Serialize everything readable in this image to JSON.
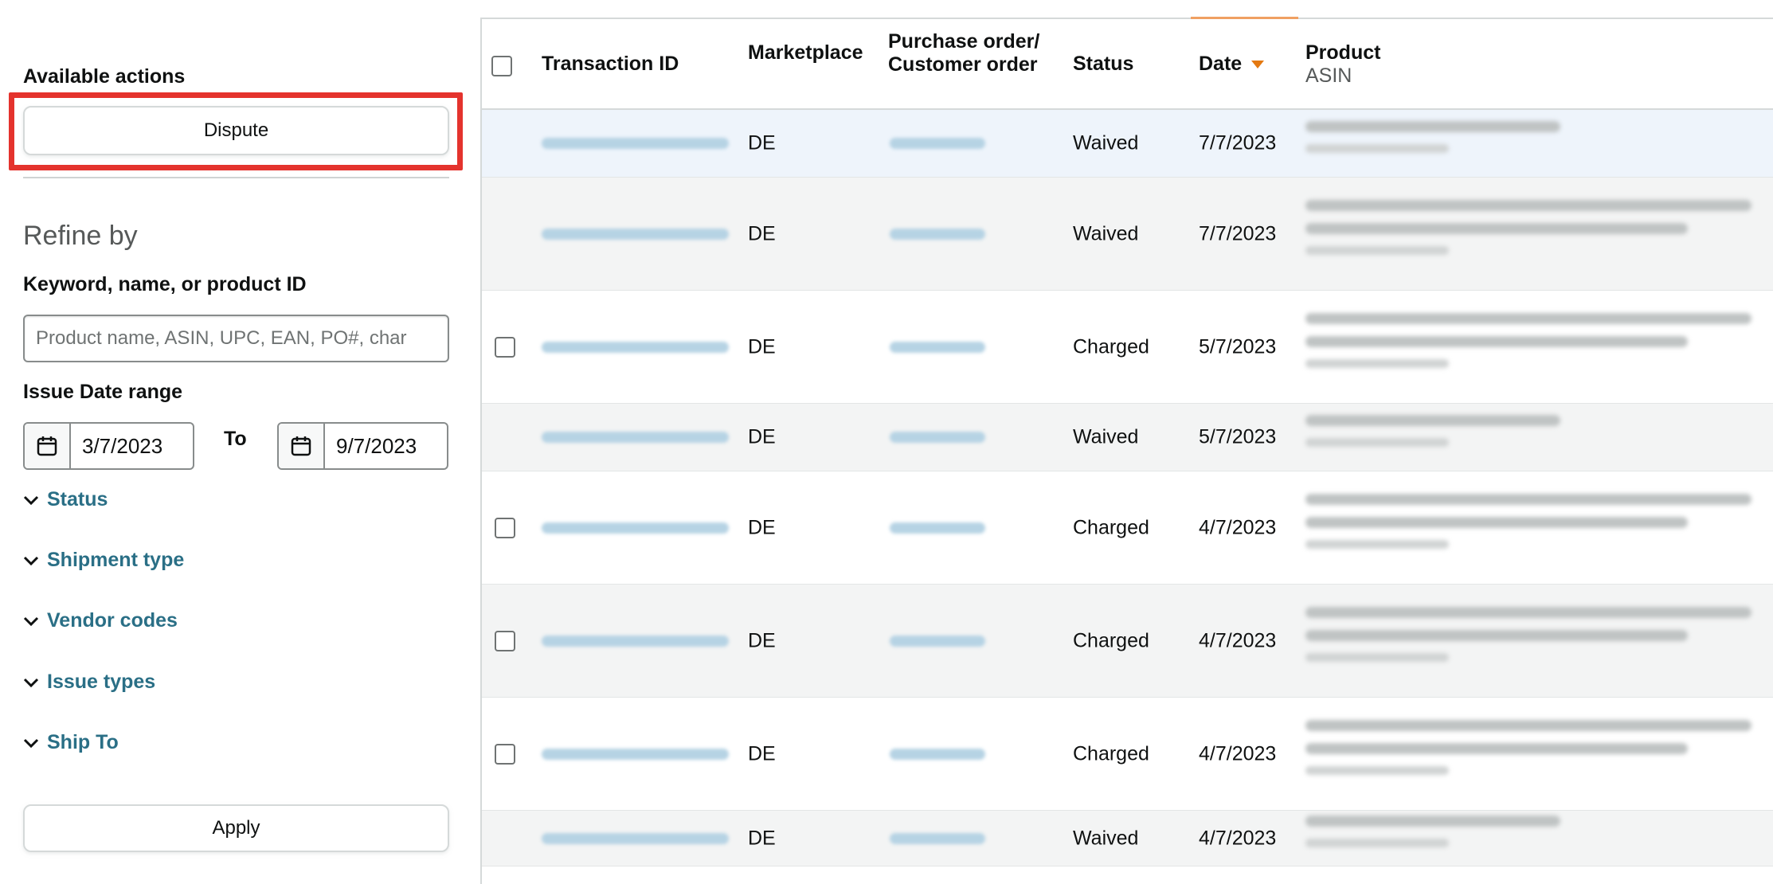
{
  "sidebar": {
    "available_actions_label": "Available actions",
    "dispute_button": "Dispute",
    "refine_title": "Refine by",
    "keyword_label": "Keyword, name, or product ID",
    "search_placeholder": "Product name, ASIN, UPC, EAN, PO#, char",
    "issue_date_label": "Issue Date range",
    "date_from": "3/7/2023",
    "date_to_label": "To",
    "date_to": "9/7/2023",
    "filters": [
      "Status",
      "Shipment type",
      "Vendor codes",
      "Issue types",
      "Ship To"
    ],
    "apply_button": "Apply"
  },
  "table": {
    "headers": {
      "transaction_id": "Transaction ID",
      "marketplace": "Marketplace",
      "po_line1": "Purchase order/",
      "po_line2": "Customer order",
      "status": "Status",
      "date": "Date",
      "product": "Product",
      "product_sub": "ASIN"
    },
    "sorted_column": "date",
    "sort_direction": "descending",
    "rows": [
      {
        "marketplace": "DE",
        "status": "Waived",
        "date": "7/7/2023",
        "selectable": false,
        "highlighted": true
      },
      {
        "marketplace": "DE",
        "status": "Waived",
        "date": "7/7/2023",
        "selectable": false,
        "highlighted": false
      },
      {
        "marketplace": "DE",
        "status": "Charged",
        "date": "5/7/2023",
        "selectable": true,
        "highlighted": false
      },
      {
        "marketplace": "DE",
        "status": "Waived",
        "date": "5/7/2023",
        "selectable": false,
        "highlighted": false
      },
      {
        "marketplace": "DE",
        "status": "Charged",
        "date": "4/7/2023",
        "selectable": true,
        "highlighted": false
      },
      {
        "marketplace": "DE",
        "status": "Charged",
        "date": "4/7/2023",
        "selectable": true,
        "highlighted": false
      },
      {
        "marketplace": "DE",
        "status": "Charged",
        "date": "4/7/2023",
        "selectable": true,
        "highlighted": false
      },
      {
        "marketplace": "DE",
        "status": "Waived",
        "date": "4/7/2023",
        "selectable": false,
        "highlighted": false
      }
    ]
  },
  "colors": {
    "accent_red": "#e4332d",
    "link_teal": "#2a6f86",
    "sort_orange": "#e47911",
    "row_highlight": "#eef4fb",
    "row_alt": "#f3f4f4"
  },
  "icons": [
    "calendar-icon",
    "chevron-down-icon",
    "sort-caret-icon",
    "checkbox-icon"
  ]
}
